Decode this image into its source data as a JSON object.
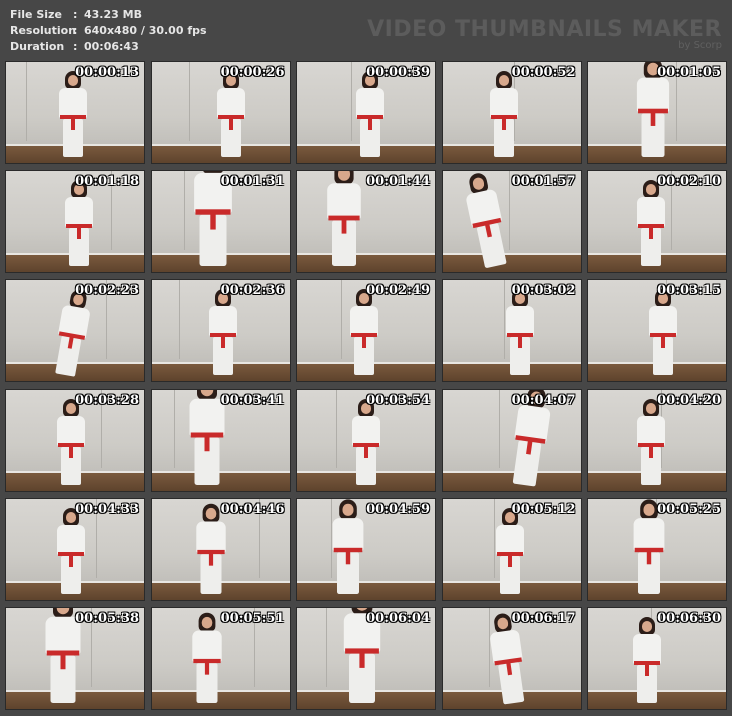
{
  "info": {
    "rows": [
      {
        "label": "File Size",
        "sep": ":",
        "value": "43.23 MB"
      },
      {
        "label": "Resolution",
        "sep": ":",
        "value": "640x480 / 30.00 fps"
      },
      {
        "label": "Duration",
        "sep": ":",
        "value": "00:06:43"
      }
    ]
  },
  "brand": {
    "title": "VIDEO THUMBNAILS MAKER",
    "subtitle": "by Scorp"
  },
  "thumbnails": [
    {
      "time": "00:00:13"
    },
    {
      "time": "00:00:26"
    },
    {
      "time": "00:00:39"
    },
    {
      "time": "00:00:52"
    },
    {
      "time": "00:01:05"
    },
    {
      "time": "00:01:18"
    },
    {
      "time": "00:01:31"
    },
    {
      "time": "00:01:44"
    },
    {
      "time": "00:01:57"
    },
    {
      "time": "00:02:10"
    },
    {
      "time": "00:02:23"
    },
    {
      "time": "00:02:36"
    },
    {
      "time": "00:02:49"
    },
    {
      "time": "00:03:02"
    },
    {
      "time": "00:03:15"
    },
    {
      "time": "00:03:28"
    },
    {
      "time": "00:03:41"
    },
    {
      "time": "00:03:54"
    },
    {
      "time": "00:04:07"
    },
    {
      "time": "00:04:20"
    },
    {
      "time": "00:04:33"
    },
    {
      "time": "00:04:46"
    },
    {
      "time": "00:04:59"
    },
    {
      "time": "00:05:12"
    },
    {
      "time": "00:05:25"
    },
    {
      "time": "00:05:38"
    },
    {
      "time": "00:05:51"
    },
    {
      "time": "00:06:04"
    },
    {
      "time": "00:06:17"
    },
    {
      "time": "00:06:30"
    }
  ],
  "colors": {
    "background": "#474747",
    "belt": "#c92a2a",
    "gi": "#f2f2f0",
    "wall": "#d2d0cb",
    "floor": "#6b4d34"
  }
}
